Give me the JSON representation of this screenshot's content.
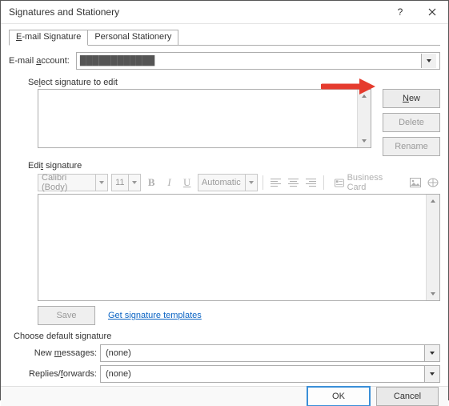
{
  "window": {
    "title": "Signatures and Stationery"
  },
  "tabs": {
    "email": "E-mail Signature",
    "stationery": "Personal Stationery"
  },
  "account": {
    "label": "E-mail account:",
    "value": "████████████"
  },
  "select_sig_label": "Select signature to edit",
  "side_buttons": {
    "new": "New",
    "delete": "Delete",
    "rename": "Rename"
  },
  "edit_label": "Edit signature",
  "toolbar": {
    "font": "Calibri (Body)",
    "size": "11",
    "bold": "B",
    "italic": "I",
    "underline": "U",
    "color": "Automatic",
    "business_card": "Business Card"
  },
  "save": {
    "label": "Save",
    "templates_link": "Get signature templates"
  },
  "defaults": {
    "heading": "Choose default signature",
    "new_label": "New messages:",
    "new_value": "(none)",
    "reply_label": "Replies/forwards:",
    "reply_value": "(none)"
  },
  "footer": {
    "ok": "OK",
    "cancel": "Cancel"
  }
}
